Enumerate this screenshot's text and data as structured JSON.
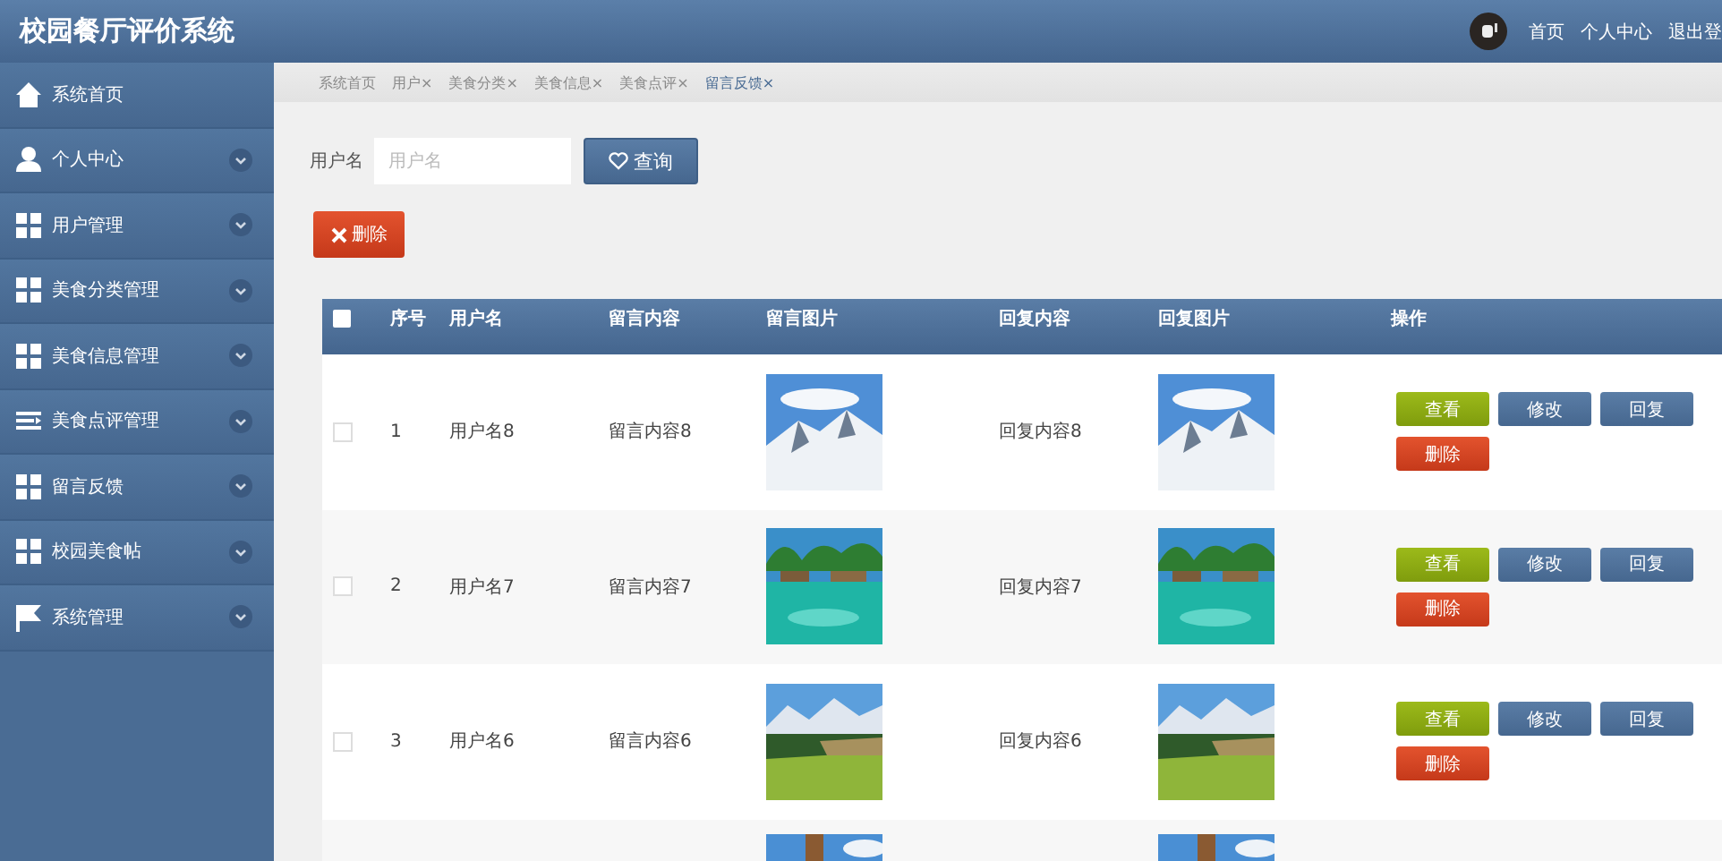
{
  "header": {
    "title": "校园餐厅评价系统",
    "links": [
      "首页",
      "个人中心",
      "退出登"
    ]
  },
  "sidebar": {
    "items": [
      {
        "label": "系统首页",
        "kind": "home"
      },
      {
        "label": "个人中心",
        "kind": "user"
      },
      {
        "label": "用户管理",
        "kind": "grid"
      },
      {
        "label": "美食分类管理",
        "kind": "grid"
      },
      {
        "label": "美食信息管理",
        "kind": "grid"
      },
      {
        "label": "美食点评管理",
        "kind": "list"
      },
      {
        "label": "留言反馈",
        "kind": "grid"
      },
      {
        "label": "校园美食帖",
        "kind": "grid"
      },
      {
        "label": "系统管理",
        "kind": "flag"
      }
    ]
  },
  "tabs": [
    {
      "label": "系统首页",
      "selected": false
    },
    {
      "label": "用户×",
      "selected": false
    },
    {
      "label": "美食分类×",
      "selected": false
    },
    {
      "label": "美食信息×",
      "selected": false
    },
    {
      "label": "美食点评×",
      "selected": false
    },
    {
      "label": "留言反馈×",
      "selected": true
    }
  ],
  "search": {
    "label": "用户名",
    "placeholder": "用户名",
    "button": "查询"
  },
  "delete_button": "删除",
  "table": {
    "select_all_checked": false,
    "columns": [
      "序号",
      "用户名",
      "留言内容",
      "留言图片",
      "回复内容",
      "回复图片",
      "操作"
    ],
    "rows": [
      {
        "kind": "full",
        "checked": false,
        "index": "1",
        "user": "用户名8",
        "content": "留言内容8",
        "reply": "回复内容8",
        "actions": [
          "查看",
          "修改",
          "回复",
          "删除"
        ]
      },
      {
        "kind": "full",
        "checked": false,
        "index": "2",
        "user": "用户名7",
        "content": "留言内容7",
        "reply": "回复内容7",
        "actions": [
          "查看",
          "修改",
          "回复",
          "删除"
        ]
      },
      {
        "kind": "full",
        "checked": false,
        "index": "3",
        "user": "用户名6",
        "content": "留言内容6",
        "reply": "回复内容6",
        "actions": [
          "查看",
          "修改",
          "回复",
          "删除"
        ]
      },
      {
        "kind": "partial"
      }
    ]
  }
}
